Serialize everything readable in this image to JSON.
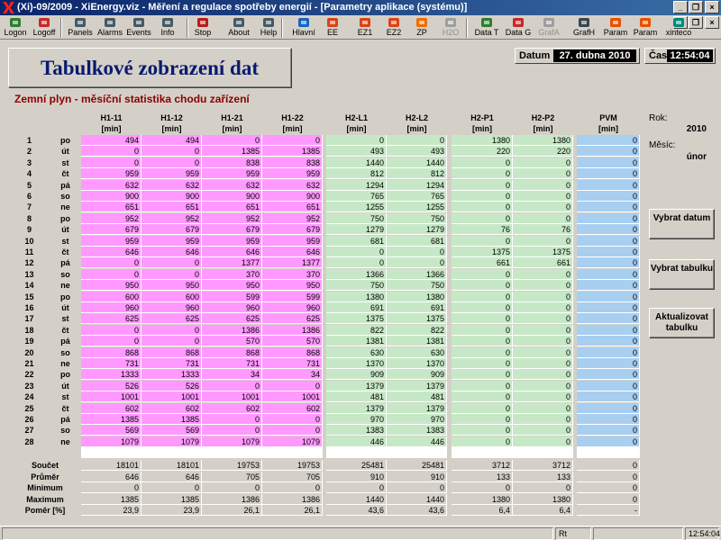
{
  "window": {
    "title": "(Xi)-09/2009 - XiEnergy.viz - Měření a regulace spotřeby energií - [Parametry aplikace (systému)]",
    "controls": [
      "_",
      "❐",
      "×"
    ],
    "doc_controls": [
      "_",
      "❐",
      "×"
    ]
  },
  "toolbar": [
    {
      "label": "Logon",
      "icon": "logon-icon",
      "color": "#2e7d32",
      "enabled": true
    },
    {
      "label": "Logoff",
      "icon": "logoff-icon",
      "color": "#c62828",
      "enabled": true
    },
    {
      "label": "Panels",
      "icon": "panels-icon",
      "color": "#455a64",
      "enabled": true
    },
    {
      "label": "Alarms",
      "icon": "alarms-icon",
      "color": "#455a64",
      "enabled": true
    },
    {
      "label": "Events",
      "icon": "events-icon",
      "color": "#455a64",
      "enabled": true
    },
    {
      "label": "Info",
      "icon": "info-icon",
      "color": "#455a64",
      "enabled": true
    },
    {
      "label": "Stop",
      "icon": "stop-icon",
      "color": "#b71c1c",
      "enabled": true
    },
    {
      "label": "About",
      "icon": "about-icon",
      "color": "#455a64",
      "enabled": true
    },
    {
      "label": "Help",
      "icon": "help-icon",
      "color": "#455a64",
      "enabled": true
    },
    {
      "label": "Hlavní",
      "icon": "home-icon",
      "color": "#1565c0",
      "enabled": true
    },
    {
      "label": "EE",
      "icon": "lightning-icon",
      "color": "#d84315",
      "enabled": true
    },
    {
      "label": "EZ1",
      "icon": "lightning-icon",
      "color": "#d84315",
      "enabled": true
    },
    {
      "label": "EZ2",
      "icon": "lightning-icon",
      "color": "#d84315",
      "enabled": true
    },
    {
      "label": "ZP",
      "icon": "gas-icon",
      "color": "#ef6c00",
      "enabled": true
    },
    {
      "label": "H2O",
      "icon": "water-icon",
      "color": "#9e9e9e",
      "enabled": false
    },
    {
      "label": "Data T",
      "icon": "table-icon",
      "color": "#2e7d32",
      "enabled": true
    },
    {
      "label": "Data G",
      "icon": "bar-chart-icon",
      "color": "#c62828",
      "enabled": true
    },
    {
      "label": "GrafA",
      "icon": "graph-icon",
      "color": "#9e9e9e",
      "enabled": false
    },
    {
      "label": "GrafH",
      "icon": "graph-icon",
      "color": "#37474f",
      "enabled": true
    },
    {
      "label": "Param",
      "icon": "tools-icon",
      "color": "#e65100",
      "enabled": true
    },
    {
      "label": "Param",
      "icon": "tools-icon",
      "color": "#e65100",
      "enabled": true
    },
    {
      "label": "xinteco",
      "icon": "xinteco-icon",
      "color": "#00897b",
      "enabled": true
    }
  ],
  "page": {
    "title": "Tabulkové zobrazení dat",
    "subtitle": "Zemní plyn - měsíční statistika chodu zařízení",
    "date_label": "Datum",
    "date_value": "27. dubna 2010",
    "time_label": "Čas",
    "time_value": "12:54:04"
  },
  "side": {
    "year_label": "Rok:",
    "year_value": "2010",
    "month_label": "Měsíc:",
    "month_value": "únor",
    "btn_select_date": "Vybrat datum",
    "btn_select_table": "Vybrat tabulku",
    "btn_refresh_table": "Aktualizovat tabulku"
  },
  "colors": {
    "pink": "#ff99ff",
    "green": "#c6e8c6",
    "blue": "#a8cef0",
    "grey": "#d4d0c8"
  },
  "table": {
    "columns": [
      {
        "name": "H1-11",
        "unit": "[min]",
        "group": "pink"
      },
      {
        "name": "H1-12",
        "unit": "[min]",
        "group": "pink"
      },
      {
        "name": "H1-21",
        "unit": "[min]",
        "group": "pink"
      },
      {
        "name": "H1-22",
        "unit": "[min]",
        "group": "pink"
      },
      {
        "name": "H2-L1",
        "unit": "[min]",
        "group": "green"
      },
      {
        "name": "H2-L2",
        "unit": "[min]",
        "group": "green"
      },
      {
        "name": "H2-P1",
        "unit": "[min]",
        "group": "green"
      },
      {
        "name": "H2-P2",
        "unit": "[min]",
        "group": "green"
      },
      {
        "name": "PVM",
        "unit": "[min]",
        "group": "blue"
      }
    ],
    "rows": [
      {
        "day": "1",
        "wd": "po",
        "v": [
          "494",
          "494",
          "0",
          "0",
          "0",
          "0",
          "1380",
          "1380",
          "0"
        ]
      },
      {
        "day": "2",
        "wd": "út",
        "v": [
          "0",
          "0",
          "1385",
          "1385",
          "493",
          "493",
          "220",
          "220",
          "0"
        ]
      },
      {
        "day": "3",
        "wd": "st",
        "v": [
          "0",
          "0",
          "838",
          "838",
          "1440",
          "1440",
          "0",
          "0",
          "0"
        ]
      },
      {
        "day": "4",
        "wd": "čt",
        "v": [
          "959",
          "959",
          "959",
          "959",
          "812",
          "812",
          "0",
          "0",
          "0"
        ]
      },
      {
        "day": "5",
        "wd": "pá",
        "v": [
          "632",
          "632",
          "632",
          "632",
          "1294",
          "1294",
          "0",
          "0",
          "0"
        ]
      },
      {
        "day": "6",
        "wd": "so",
        "v": [
          "900",
          "900",
          "900",
          "900",
          "765",
          "765",
          "0",
          "0",
          "0"
        ]
      },
      {
        "day": "7",
        "wd": "ne",
        "v": [
          "651",
          "651",
          "651",
          "651",
          "1255",
          "1255",
          "0",
          "0",
          "0"
        ]
      },
      {
        "day": "8",
        "wd": "po",
        "v": [
          "952",
          "952",
          "952",
          "952",
          "750",
          "750",
          "0",
          "0",
          "0"
        ]
      },
      {
        "day": "9",
        "wd": "út",
        "v": [
          "679",
          "679",
          "679",
          "679",
          "1279",
          "1279",
          "76",
          "76",
          "0"
        ]
      },
      {
        "day": "10",
        "wd": "st",
        "v": [
          "959",
          "959",
          "959",
          "959",
          "681",
          "681",
          "0",
          "0",
          "0"
        ]
      },
      {
        "day": "11",
        "wd": "čt",
        "v": [
          "646",
          "646",
          "646",
          "646",
          "0",
          "0",
          "1375",
          "1375",
          "0"
        ]
      },
      {
        "day": "12",
        "wd": "pá",
        "v": [
          "0",
          "0",
          "1377",
          "1377",
          "0",
          "0",
          "661",
          "661",
          "0"
        ]
      },
      {
        "day": "13",
        "wd": "so",
        "v": [
          "0",
          "0",
          "370",
          "370",
          "1366",
          "1366",
          "0",
          "0",
          "0"
        ]
      },
      {
        "day": "14",
        "wd": "ne",
        "v": [
          "950",
          "950",
          "950",
          "950",
          "750",
          "750",
          "0",
          "0",
          "0"
        ]
      },
      {
        "day": "15",
        "wd": "po",
        "v": [
          "600",
          "600",
          "599",
          "599",
          "1380",
          "1380",
          "0",
          "0",
          "0"
        ]
      },
      {
        "day": "16",
        "wd": "út",
        "v": [
          "960",
          "960",
          "960",
          "960",
          "691",
          "691",
          "0",
          "0",
          "0"
        ]
      },
      {
        "day": "17",
        "wd": "st",
        "v": [
          "625",
          "625",
          "625",
          "625",
          "1375",
          "1375",
          "0",
          "0",
          "0"
        ]
      },
      {
        "day": "18",
        "wd": "čt",
        "v": [
          "0",
          "0",
          "1386",
          "1386",
          "822",
          "822",
          "0",
          "0",
          "0"
        ]
      },
      {
        "day": "19",
        "wd": "pá",
        "v": [
          "0",
          "0",
          "570",
          "570",
          "1381",
          "1381",
          "0",
          "0",
          "0"
        ]
      },
      {
        "day": "20",
        "wd": "so",
        "v": [
          "868",
          "868",
          "868",
          "868",
          "630",
          "630",
          "0",
          "0",
          "0"
        ]
      },
      {
        "day": "21",
        "wd": "ne",
        "v": [
          "731",
          "731",
          "731",
          "731",
          "1370",
          "1370",
          "0",
          "0",
          "0"
        ]
      },
      {
        "day": "22",
        "wd": "po",
        "v": [
          "1333",
          "1333",
          "34",
          "34",
          "909",
          "909",
          "0",
          "0",
          "0"
        ]
      },
      {
        "day": "23",
        "wd": "út",
        "v": [
          "526",
          "526",
          "0",
          "0",
          "1379",
          "1379",
          "0",
          "0",
          "0"
        ]
      },
      {
        "day": "24",
        "wd": "st",
        "v": [
          "1001",
          "1001",
          "1001",
          "1001",
          "481",
          "481",
          "0",
          "0",
          "0"
        ]
      },
      {
        "day": "25",
        "wd": "čt",
        "v": [
          "602",
          "602",
          "602",
          "602",
          "1379",
          "1379",
          "0",
          "0",
          "0"
        ]
      },
      {
        "day": "26",
        "wd": "pá",
        "v": [
          "1385",
          "1385",
          "0",
          "0",
          "970",
          "970",
          "0",
          "0",
          "0"
        ]
      },
      {
        "day": "27",
        "wd": "so",
        "v": [
          "569",
          "569",
          "0",
          "0",
          "1383",
          "1383",
          "0",
          "0",
          "0"
        ]
      },
      {
        "day": "28",
        "wd": "ne",
        "v": [
          "1079",
          "1079",
          "1079",
          "1079",
          "446",
          "446",
          "0",
          "0",
          "0"
        ]
      }
    ],
    "summary": [
      {
        "label": "Součet",
        "v": [
          "18101",
          "18101",
          "19753",
          "19753",
          "25481",
          "25481",
          "3712",
          "3712",
          "0"
        ]
      },
      {
        "label": "Průměr",
        "v": [
          "646",
          "646",
          "705",
          "705",
          "910",
          "910",
          "133",
          "133",
          "0"
        ]
      },
      {
        "label": "Minimum",
        "v": [
          "0",
          "0",
          "0",
          "0",
          "0",
          "0",
          "0",
          "0",
          "0"
        ]
      },
      {
        "label": "Maximum",
        "v": [
          "1385",
          "1385",
          "1386",
          "1386",
          "1440",
          "1440",
          "1380",
          "1380",
          "0"
        ]
      },
      {
        "label": "Poměr [%]",
        "v": [
          "23,9",
          "23,9",
          "26,1",
          "26,1",
          "43,6",
          "43,6",
          "6,4",
          "6,4",
          "-"
        ]
      }
    ]
  },
  "statusbar": {
    "mode": "Rt",
    "time": "12:54:04"
  }
}
